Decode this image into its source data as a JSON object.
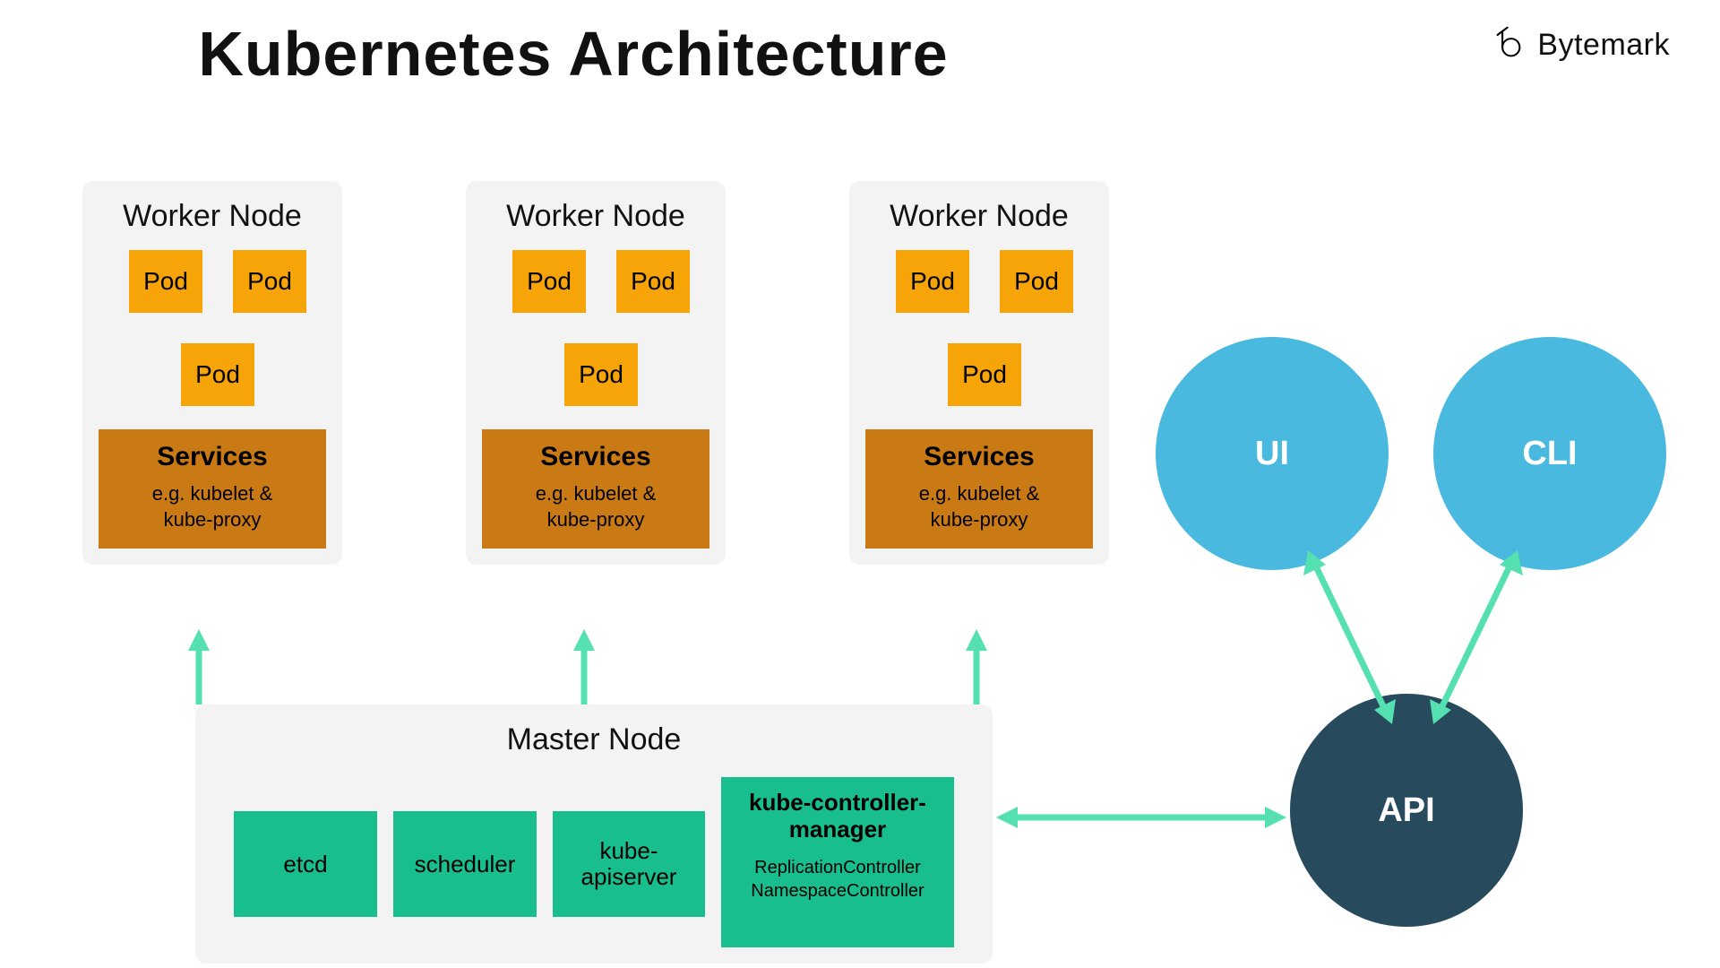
{
  "title": "Kubernetes Architecture",
  "logo": {
    "brand": "Bytemark"
  },
  "colors": {
    "pod": "#f7a409",
    "services": "#c97a14",
    "masterBox": "#18be8e",
    "circleLight": "#4ab9df",
    "circleDark": "#274a5d",
    "arrow": "#54e0b0",
    "card": "#f3f3f3"
  },
  "workers": [
    {
      "title": "Worker Node",
      "pods": [
        "Pod",
        "Pod",
        "Pod"
      ],
      "services_head": "Services",
      "services_sub1": "e.g. kubelet &",
      "services_sub2": "kube-proxy"
    },
    {
      "title": "Worker Node",
      "pods": [
        "Pod",
        "Pod",
        "Pod"
      ],
      "services_head": "Services",
      "services_sub1": "e.g. kubelet &",
      "services_sub2": "kube-proxy"
    },
    {
      "title": "Worker Node",
      "pods": [
        "Pod",
        "Pod",
        "Pod"
      ],
      "services_head": "Services",
      "services_sub1": "e.g. kubelet &",
      "services_sub2": "kube-proxy"
    }
  ],
  "master": {
    "title": "Master Node",
    "etcd": "etcd",
    "scheduler": "scheduler",
    "apiserver_l1": "kube-",
    "apiserver_l2": "apiserver",
    "controller_head_l1": "kube-controller-",
    "controller_head_l2": "manager",
    "controller_sub_l1": "ReplicationController",
    "controller_sub_l2": "NamespaceController"
  },
  "circles": {
    "ui": "UI",
    "cli": "CLI",
    "api": "API"
  }
}
